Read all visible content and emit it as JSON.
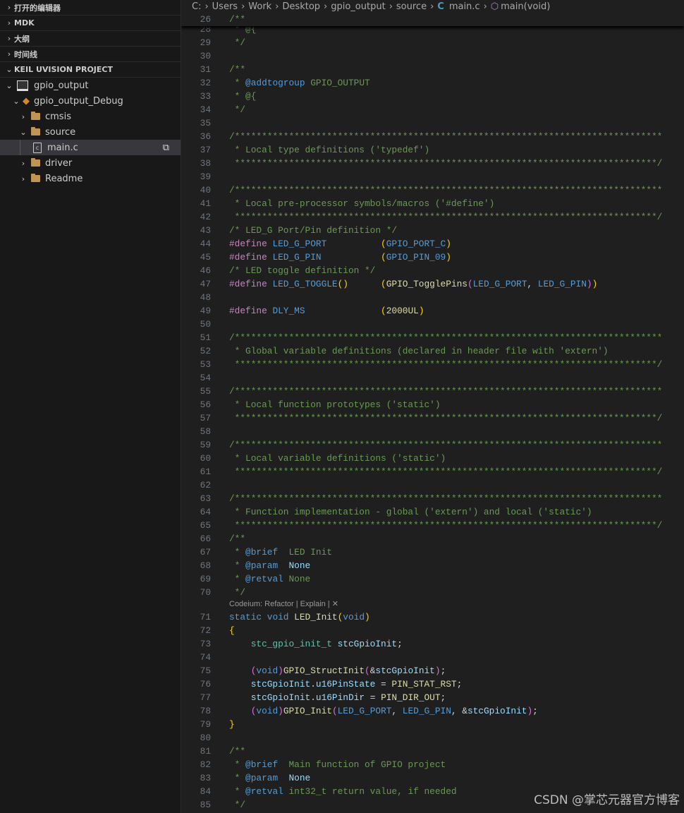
{
  "sidebar": {
    "sections": [
      {
        "label": "打开的编辑器",
        "expanded": false
      },
      {
        "label": "MDK",
        "expanded": false
      },
      {
        "label": "大纲",
        "expanded": false
      },
      {
        "label": "时间线",
        "expanded": false
      },
      {
        "label": "KEIL UVISION PROJECT",
        "expanded": true
      }
    ],
    "tree": [
      {
        "label": "gpio_output",
        "level": 1,
        "icon": "project-icon",
        "expanded": true
      },
      {
        "label": "gpio_output_Debug",
        "level": 2,
        "icon": "target-icon",
        "expanded": true
      },
      {
        "label": "cmsis",
        "level": 3,
        "icon": "folder-icon",
        "expanded": false
      },
      {
        "label": "source",
        "level": 3,
        "icon": "folder-icon",
        "expanded": true
      },
      {
        "label": "main.c",
        "level": 4,
        "icon": "c-file-icon",
        "selected": true
      },
      {
        "label": "driver",
        "level": 3,
        "icon": "folder-icon",
        "expanded": false
      },
      {
        "label": "Readme",
        "level": 3,
        "icon": "folder-icon",
        "expanded": false
      }
    ]
  },
  "breadcrumb": [
    "C:",
    "Users",
    "Work",
    "Desktop",
    "gpio_output",
    "source",
    "main.c",
    "main(void)"
  ],
  "sticky": {
    "num": "26",
    "tokens": [
      [
        "c",
        "/**"
      ]
    ]
  },
  "codelens": {
    "text": "Codeium: Refactor | Explain | ✕",
    "after_line": "70"
  },
  "lines": [
    {
      "num": "28",
      "tokens": [
        [
          "c",
          " * @{"
        ]
      ]
    },
    {
      "num": "29",
      "tokens": [
        [
          "c",
          " */"
        ]
      ]
    },
    {
      "num": "30",
      "tokens": []
    },
    {
      "num": "31",
      "tokens": [
        [
          "c",
          "/**"
        ]
      ]
    },
    {
      "num": "32",
      "tokens": [
        [
          "c",
          " * "
        ],
        [
          "t",
          "@addtogroup"
        ],
        [
          "c",
          " GPIO_OUTPUT"
        ]
      ]
    },
    {
      "num": "33",
      "tokens": [
        [
          "c",
          " * @{"
        ]
      ]
    },
    {
      "num": "34",
      "tokens": [
        [
          "c",
          " */"
        ]
      ]
    },
    {
      "num": "35",
      "tokens": []
    },
    {
      "num": "36",
      "tokens": [
        [
          "c",
          "/*******************************************************************************"
        ]
      ]
    },
    {
      "num": "37",
      "tokens": [
        [
          "c",
          " * Local type definitions ('typedef')"
        ]
      ]
    },
    {
      "num": "38",
      "tokens": [
        [
          "c",
          " ******************************************************************************/"
        ]
      ]
    },
    {
      "num": "39",
      "tokens": []
    },
    {
      "num": "40",
      "tokens": [
        [
          "c",
          "/*******************************************************************************"
        ]
      ]
    },
    {
      "num": "41",
      "tokens": [
        [
          "c",
          " * Local pre-processor symbols/macros ('#define')"
        ]
      ]
    },
    {
      "num": "42",
      "tokens": [
        [
          "c",
          " ******************************************************************************/"
        ]
      ]
    },
    {
      "num": "43",
      "tokens": [
        [
          "c",
          "/* LED_G Port/Pin definition */"
        ]
      ]
    },
    {
      "num": "44",
      "tokens": [
        [
          "p",
          "#define"
        ],
        [
          "w",
          " "
        ],
        [
          "m",
          "LED_G_PORT"
        ],
        [
          "w",
          "          "
        ],
        [
          "y",
          "("
        ],
        [
          "m",
          "GPIO_PORT_C"
        ],
        [
          "y",
          ")"
        ]
      ]
    },
    {
      "num": "45",
      "tokens": [
        [
          "p",
          "#define"
        ],
        [
          "w",
          " "
        ],
        [
          "m",
          "LED_G_PIN"
        ],
        [
          "w",
          "           "
        ],
        [
          "y",
          "("
        ],
        [
          "m",
          "GPIO_PIN_09"
        ],
        [
          "y",
          ")"
        ]
      ]
    },
    {
      "num": "46",
      "tokens": [
        [
          "c",
          "/* LED toggle definition */"
        ]
      ]
    },
    {
      "num": "47",
      "tokens": [
        [
          "p",
          "#define"
        ],
        [
          "w",
          " "
        ],
        [
          "m",
          "LED_G_TOGGLE"
        ],
        [
          "y",
          "()"
        ],
        [
          "w",
          "      "
        ],
        [
          "y",
          "("
        ],
        [
          "f",
          "GPIO_TogglePins"
        ],
        [
          "k",
          "("
        ],
        [
          "m",
          "LED_G_PORT"
        ],
        [
          "w",
          ", "
        ],
        [
          "m",
          "LED_G_PIN"
        ],
        [
          "k",
          ")"
        ],
        [
          "y",
          ")"
        ]
      ]
    },
    {
      "num": "48",
      "tokens": []
    },
    {
      "num": "49",
      "tokens": [
        [
          "p",
          "#define"
        ],
        [
          "w",
          " "
        ],
        [
          "m",
          "DLY_MS"
        ],
        [
          "w",
          "              "
        ],
        [
          "y",
          "("
        ],
        [
          "f",
          "2000UL"
        ],
        [
          "y",
          ")"
        ]
      ]
    },
    {
      "num": "50",
      "tokens": []
    },
    {
      "num": "51",
      "tokens": [
        [
          "c",
          "/*******************************************************************************"
        ]
      ]
    },
    {
      "num": "52",
      "tokens": [
        [
          "c",
          " * Global variable definitions (declared in header file with 'extern')"
        ]
      ]
    },
    {
      "num": "53",
      "tokens": [
        [
          "c",
          " ******************************************************************************/"
        ]
      ]
    },
    {
      "num": "54",
      "tokens": []
    },
    {
      "num": "55",
      "tokens": [
        [
          "c",
          "/*******************************************************************************"
        ]
      ]
    },
    {
      "num": "56",
      "tokens": [
        [
          "c",
          " * Local function prototypes ('static')"
        ]
      ]
    },
    {
      "num": "57",
      "tokens": [
        [
          "c",
          " ******************************************************************************/"
        ]
      ]
    },
    {
      "num": "58",
      "tokens": []
    },
    {
      "num": "59",
      "tokens": [
        [
          "c",
          "/*******************************************************************************"
        ]
      ]
    },
    {
      "num": "60",
      "tokens": [
        [
          "c",
          " * Local variable definitions ('static')"
        ]
      ]
    },
    {
      "num": "61",
      "tokens": [
        [
          "c",
          " ******************************************************************************/"
        ]
      ]
    },
    {
      "num": "62",
      "tokens": []
    },
    {
      "num": "63",
      "tokens": [
        [
          "c",
          "/*******************************************************************************"
        ]
      ]
    },
    {
      "num": "64",
      "tokens": [
        [
          "c",
          " * Function implementation - global ('extern') and local ('static')"
        ]
      ]
    },
    {
      "num": "65",
      "tokens": [
        [
          "c",
          " ******************************************************************************/"
        ]
      ]
    },
    {
      "num": "66",
      "tokens": [
        [
          "c",
          "/**"
        ]
      ]
    },
    {
      "num": "67",
      "tokens": [
        [
          "c",
          " * "
        ],
        [
          "t",
          "@brief"
        ],
        [
          "c",
          "  LED Init"
        ]
      ]
    },
    {
      "num": "68",
      "tokens": [
        [
          "c",
          " * "
        ],
        [
          "t",
          "@param"
        ],
        [
          "c",
          "  "
        ],
        [
          "tp",
          "None"
        ]
      ]
    },
    {
      "num": "69",
      "tokens": [
        [
          "c",
          " * "
        ],
        [
          "t",
          "@retval"
        ],
        [
          "c",
          " None"
        ]
      ]
    },
    {
      "num": "70",
      "tokens": [
        [
          "c",
          " */"
        ]
      ]
    },
    {
      "num": "71",
      "tokens": [
        [
          "kw",
          "static"
        ],
        [
          "w",
          " "
        ],
        [
          "kw",
          "void"
        ],
        [
          "w",
          " "
        ],
        [
          "f",
          "LED_Init"
        ],
        [
          "y",
          "("
        ],
        [
          "kw",
          "void"
        ],
        [
          "y",
          ")"
        ]
      ]
    },
    {
      "num": "72",
      "tokens": [
        [
          "y",
          "{"
        ]
      ]
    },
    {
      "num": "73",
      "tokens": [
        [
          "w",
          "    "
        ],
        [
          "ty",
          "stc_gpio_init_t"
        ],
        [
          "w",
          " "
        ],
        [
          "v",
          "stcGpioInit"
        ],
        [
          "w",
          ";"
        ]
      ]
    },
    {
      "num": "74",
      "tokens": []
    },
    {
      "num": "75",
      "tokens": [
        [
          "w",
          "    "
        ],
        [
          "k",
          "("
        ],
        [
          "kw",
          "void"
        ],
        [
          "k",
          ")"
        ],
        [
          "f",
          "GPIO_StructInit"
        ],
        [
          "k",
          "("
        ],
        [
          "w",
          "&"
        ],
        [
          "v",
          "stcGpioInit"
        ],
        [
          "k",
          ")"
        ],
        [
          "w",
          ";"
        ]
      ]
    },
    {
      "num": "76",
      "tokens": [
        [
          "w",
          "    "
        ],
        [
          "v",
          "stcGpioInit"
        ],
        [
          "w",
          "."
        ],
        [
          "v",
          "u16PinState"
        ],
        [
          "w",
          " = "
        ],
        [
          "f",
          "PIN_STAT_RST"
        ],
        [
          "w",
          ";"
        ]
      ]
    },
    {
      "num": "77",
      "tokens": [
        [
          "w",
          "    "
        ],
        [
          "v",
          "stcGpioInit"
        ],
        [
          "w",
          "."
        ],
        [
          "v",
          "u16PinDir"
        ],
        [
          "w",
          " = "
        ],
        [
          "f",
          "PIN_DIR_OUT"
        ],
        [
          "w",
          ";"
        ]
      ]
    },
    {
      "num": "78",
      "tokens": [
        [
          "w",
          "    "
        ],
        [
          "k",
          "("
        ],
        [
          "kw",
          "void"
        ],
        [
          "k",
          ")"
        ],
        [
          "f",
          "GPIO_Init"
        ],
        [
          "k",
          "("
        ],
        [
          "m",
          "LED_G_PORT"
        ],
        [
          "w",
          ", "
        ],
        [
          "m",
          "LED_G_PIN"
        ],
        [
          "w",
          ", &"
        ],
        [
          "v",
          "stcGpioInit"
        ],
        [
          "k",
          ")"
        ],
        [
          "w",
          ";"
        ]
      ]
    },
    {
      "num": "79",
      "tokens": [
        [
          "y",
          "}"
        ]
      ]
    },
    {
      "num": "80",
      "tokens": []
    },
    {
      "num": "81",
      "tokens": [
        [
          "c",
          "/**"
        ]
      ]
    },
    {
      "num": "82",
      "tokens": [
        [
          "c",
          " * "
        ],
        [
          "t",
          "@brief"
        ],
        [
          "c",
          "  Main function of GPIO project"
        ]
      ]
    },
    {
      "num": "83",
      "tokens": [
        [
          "c",
          " * "
        ],
        [
          "t",
          "@param"
        ],
        [
          "c",
          "  "
        ],
        [
          "tp",
          "None"
        ]
      ]
    },
    {
      "num": "84",
      "tokens": [
        [
          "c",
          " * "
        ],
        [
          "t",
          "@retval"
        ],
        [
          "c",
          " int32_t return value, if needed"
        ]
      ]
    },
    {
      "num": "85",
      "tokens": [
        [
          "c",
          " */"
        ]
      ]
    }
  ],
  "watermark": "CSDN @掌芯元器官方博客"
}
